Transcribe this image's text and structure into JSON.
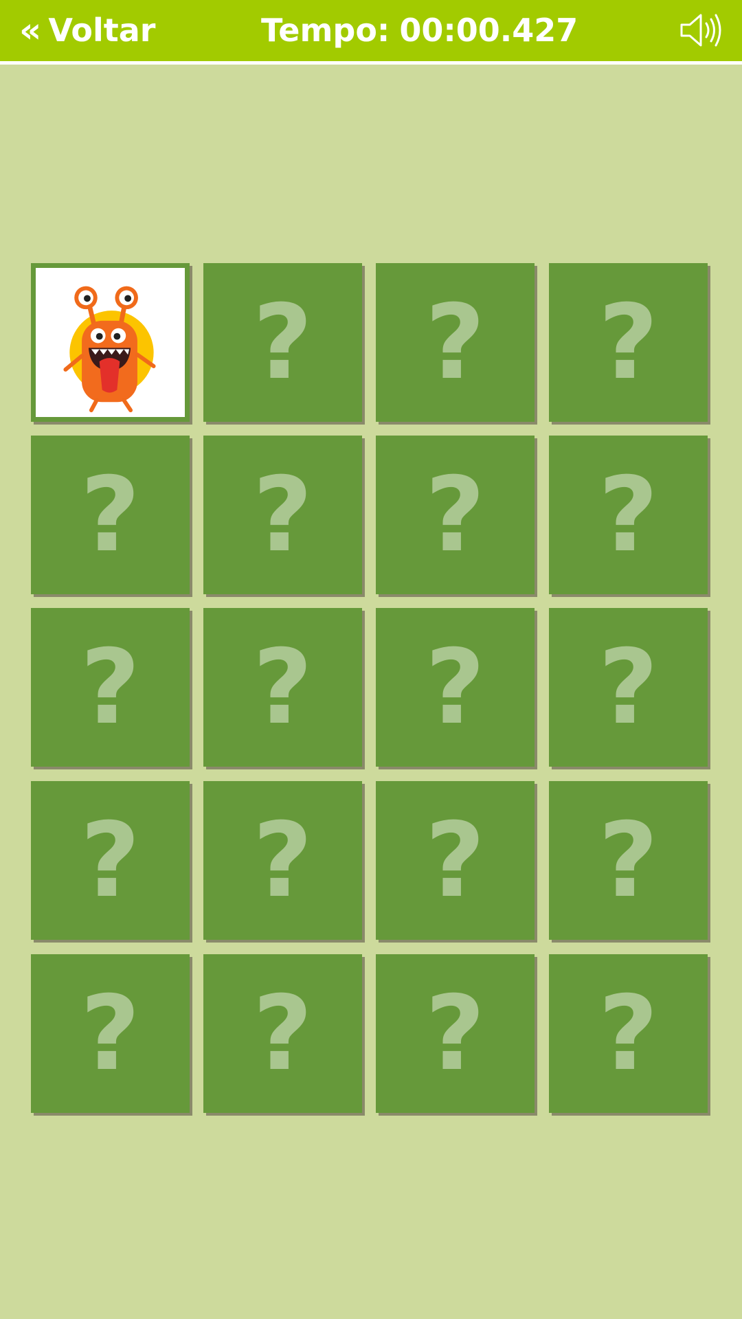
{
  "header": {
    "back_chevron": "«",
    "back_label": "Voltar",
    "timer_label": "Tempo:",
    "timer_value": "00:00.427",
    "sound_icon": "speaker-icon",
    "bar_color": "#a2cb00"
  },
  "board": {
    "rows": 5,
    "columns": 4,
    "hidden_symbol": "?",
    "card_color": "#66993a",
    "revealed_card": {
      "index": 0,
      "picture": "orange-monster"
    }
  }
}
